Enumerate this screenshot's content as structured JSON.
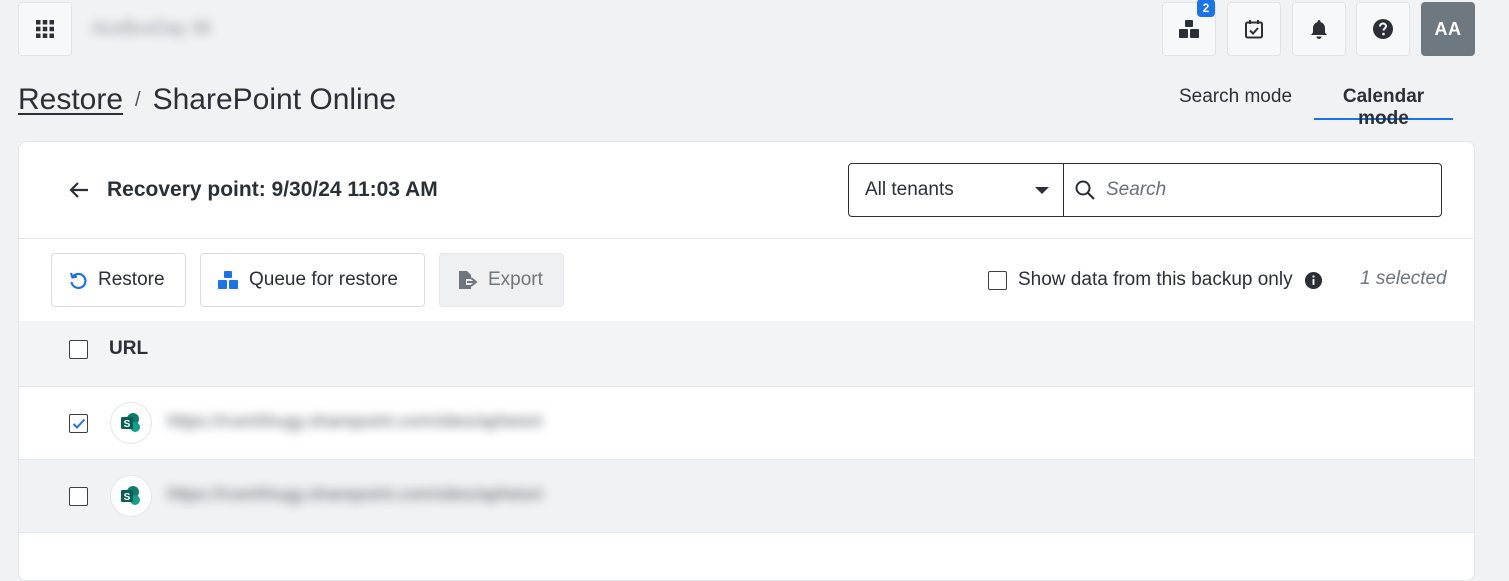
{
  "topbar": {
    "org_name": "AceBoxDay 36",
    "queue_badge": "2",
    "avatar_initials": "AA",
    "icons": [
      "grid-icon",
      "queue-icon",
      "calendar-check-icon",
      "bell-icon",
      "help-icon"
    ]
  },
  "breadcrumb": {
    "parent": "Restore",
    "separator": "/",
    "current": "SharePoint Online"
  },
  "modes": {
    "search": "Search mode",
    "calendar": "Calendar mode",
    "active": "calendar"
  },
  "header": {
    "title": "Recovery point: 9/30/24 11:03 AM",
    "tenant_value": "All tenants",
    "search_placeholder": "Search"
  },
  "toolbar": {
    "restore": "Restore",
    "queue": "Queue for restore",
    "export": "Export",
    "show_data_label": "Show data from this backup only",
    "show_data_checked": false,
    "selected_count": "1 selected"
  },
  "table": {
    "columns": [
      "URL"
    ],
    "rows": [
      {
        "url": "https://rcenhhugy.sharepoint.com/sites/apheiori",
        "checked": true
      },
      {
        "url": "https://rcenhhugy.sharepoint.com/sites/apheiori",
        "checked": false
      }
    ]
  },
  "colors": {
    "accent": "#1a73e8",
    "sharepoint": "#0f7b6c",
    "avatar_bg": "#6e7880"
  }
}
